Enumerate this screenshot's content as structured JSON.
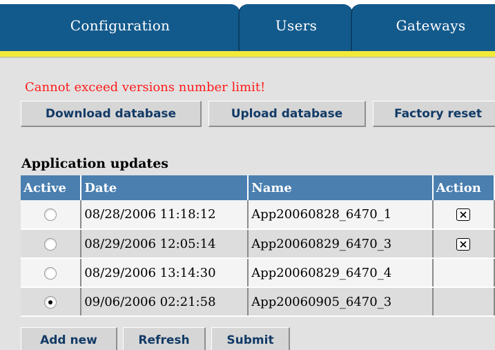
{
  "tabs": [
    {
      "label": "Configuration"
    },
    {
      "label": "Users"
    },
    {
      "label": "Gateways"
    }
  ],
  "colors": {
    "tab_bg": "#135a8c",
    "accent_rule": "#f2ea3a",
    "table_header": "#4a7fb0",
    "error": "#ff1a1a",
    "button_text": "#123a66"
  },
  "message": {
    "error": "Cannot exceed versions number limit!"
  },
  "database_buttons": {
    "download": "Download database",
    "upload": "Upload database",
    "factory_reset": "Factory reset"
  },
  "updates": {
    "title": "Application updates",
    "columns": {
      "active": "Active",
      "date": "Date",
      "name": "Name",
      "action": "Action"
    },
    "rows": [
      {
        "active": false,
        "date": "08/28/2006 11:18:12",
        "name": "App20060828_6470_1",
        "action_icon": "delete-icon"
      },
      {
        "active": false,
        "date": "08/29/2006 12:05:14",
        "name": "App20060829_6470_3",
        "action_icon": "delete-icon"
      },
      {
        "active": false,
        "date": "08/29/2006 13:14:30",
        "name": "App20060829_6470_4",
        "action_icon": ""
      },
      {
        "active": true,
        "date": "09/06/2006 02:21:58",
        "name": "App20060905_6470_3",
        "action_icon": ""
      }
    ]
  },
  "footer_buttons": {
    "add_new": "Add new",
    "refresh": "Refresh",
    "submit": "Submit"
  }
}
